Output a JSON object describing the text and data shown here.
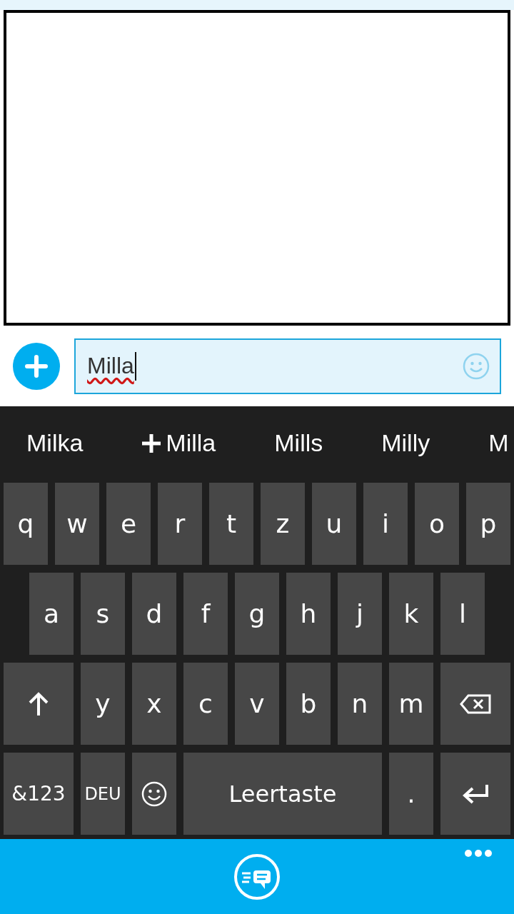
{
  "compose": {
    "value": "Milla",
    "misspelled": true
  },
  "suggestions": [
    {
      "text": "Milka",
      "kind": "word"
    },
    {
      "text": "Milla",
      "kind": "add"
    },
    {
      "text": "Mills",
      "kind": "word"
    },
    {
      "text": "Milly",
      "kind": "word"
    },
    {
      "text": "M",
      "kind": "word"
    }
  ],
  "keyboard": {
    "rows": [
      {
        "keys": [
          {
            "kind": "letter",
            "label": "q"
          },
          {
            "kind": "letter",
            "label": "w"
          },
          {
            "kind": "letter",
            "label": "e"
          },
          {
            "kind": "letter",
            "label": "r"
          },
          {
            "kind": "letter",
            "label": "t"
          },
          {
            "kind": "letter",
            "label": "z"
          },
          {
            "kind": "letter",
            "label": "u"
          },
          {
            "kind": "letter",
            "label": "i"
          },
          {
            "kind": "letter",
            "label": "o"
          },
          {
            "kind": "letter",
            "label": "p"
          }
        ]
      },
      {
        "keys": [
          {
            "kind": "letter",
            "label": "a"
          },
          {
            "kind": "letter",
            "label": "s"
          },
          {
            "kind": "letter",
            "label": "d"
          },
          {
            "kind": "letter",
            "label": "f"
          },
          {
            "kind": "letter",
            "label": "g"
          },
          {
            "kind": "letter",
            "label": "h"
          },
          {
            "kind": "letter",
            "label": "j"
          },
          {
            "kind": "letter",
            "label": "k"
          },
          {
            "kind": "letter",
            "label": "l"
          }
        ]
      },
      {
        "keys": [
          {
            "kind": "shift"
          },
          {
            "kind": "letter",
            "label": "y"
          },
          {
            "kind": "letter",
            "label": "x"
          },
          {
            "kind": "letter",
            "label": "c"
          },
          {
            "kind": "letter",
            "label": "v"
          },
          {
            "kind": "letter",
            "label": "b"
          },
          {
            "kind": "letter",
            "label": "n"
          },
          {
            "kind": "letter",
            "label": "m"
          },
          {
            "kind": "backspace"
          }
        ]
      },
      {
        "keys": [
          {
            "kind": "symbols",
            "label": "&123"
          },
          {
            "kind": "language",
            "label": "DEU"
          },
          {
            "kind": "emoji"
          },
          {
            "kind": "space",
            "label": "Leertaste"
          },
          {
            "kind": "letter",
            "label": "."
          },
          {
            "kind": "enter"
          }
        ]
      }
    ]
  }
}
